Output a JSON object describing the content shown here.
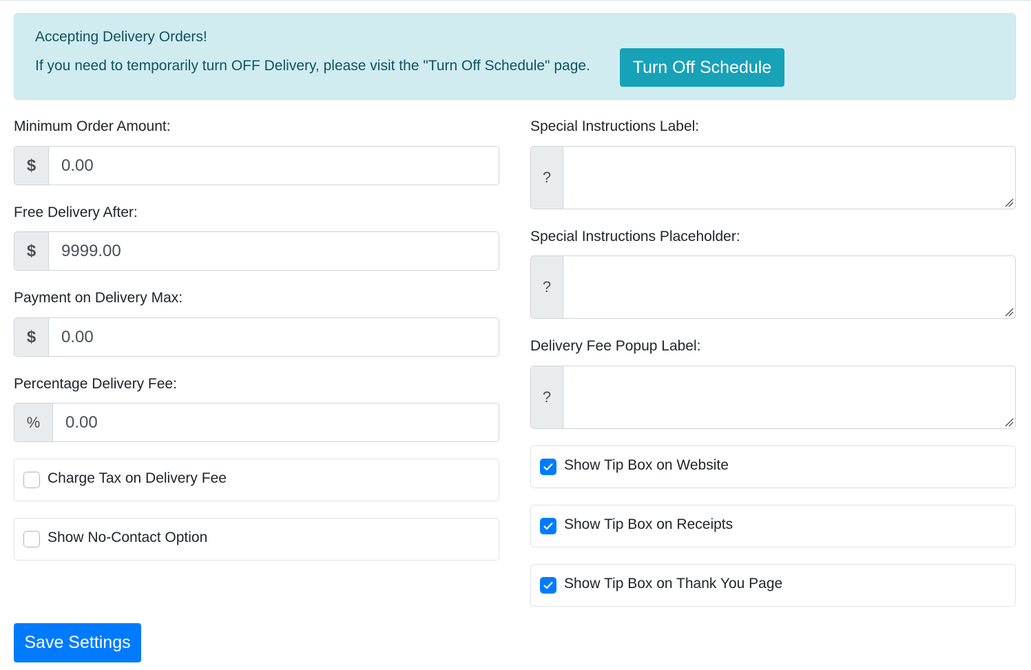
{
  "alert": {
    "title": "Accepting Delivery Orders!",
    "message": "If you need to temporarily turn OFF Delivery, please visit the \"Turn Off Schedule\" page.",
    "button_label": "Turn Off Schedule"
  },
  "left": {
    "min_order": {
      "label": "Minimum Order Amount:",
      "addon": "$",
      "value": "0.00"
    },
    "free_delivery": {
      "label": "Free Delivery After:",
      "addon": "$",
      "value": "9999.00"
    },
    "payment_max": {
      "label": "Payment on Delivery Max:",
      "addon": "$",
      "value": "0.00"
    },
    "pct_fee": {
      "label": "Percentage Delivery Fee:",
      "addon": "%",
      "value": "0.00"
    },
    "charge_tax": {
      "label": "Charge Tax on Delivery Fee",
      "checked": false
    },
    "no_contact": {
      "label": "Show No-Contact Option",
      "checked": false
    }
  },
  "right": {
    "special_label": {
      "label": "Special Instructions Label:",
      "addon": "?",
      "value": ""
    },
    "special_placeholder": {
      "label": "Special Instructions Placeholder:",
      "addon": "?",
      "value": ""
    },
    "fee_popup": {
      "label": "Delivery Fee Popup Label:",
      "addon": "?",
      "value": ""
    },
    "tip_website": {
      "label": "Show Tip Box on Website",
      "checked": true
    },
    "tip_receipts": {
      "label": "Show Tip Box on Receipts",
      "checked": true
    },
    "tip_thankyou": {
      "label": "Show Tip Box on Thank You Page",
      "checked": true
    }
  },
  "save_label": "Save Settings",
  "colors": {
    "primary": "#007bff",
    "info": "#17a2b8",
    "alert_bg": "#d1ecf1",
    "alert_text": "#0c5460"
  }
}
